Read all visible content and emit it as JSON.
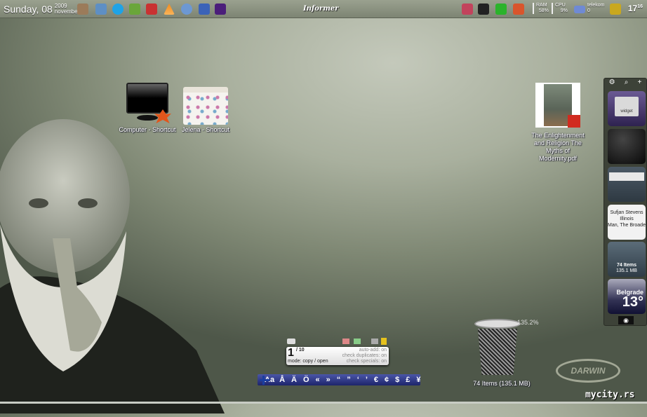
{
  "topbar": {
    "day": "Sunday, 08",
    "year": "2009",
    "month": "november",
    "title": "Informer",
    "ram_label": "RAM",
    "ram_value": "58%",
    "cpu_label": "CPU",
    "cpu_value": "9%",
    "mail_label": "telekom",
    "mail_count": "0",
    "clock_hour": "17",
    "clock_min": "16",
    "left_icons": [
      "contacts-icon",
      "explorer-icon",
      "skype-icon",
      "notepad-icon",
      "camera-app-icon",
      "vlc-icon",
      "itunes-icon",
      "word-icon",
      "winrar-icon"
    ],
    "right_icons": [
      "bookmark-icon",
      "camera-icon",
      "utorrent-icon",
      "firewall-icon"
    ]
  },
  "desktop": {
    "icons": [
      {
        "label": "Computer - Shortcut"
      },
      {
        "label": "Jelena - Shortcut"
      },
      {
        "label": "The Enlightenment and Religion The Myths of Modernity.pdf"
      }
    ]
  },
  "sidebar": {
    "widget_label": "widget",
    "music_artist": "Sufjan Stevens",
    "music_album": "Illinois",
    "music_track": "Man, The Broadest",
    "bin_items": "74 Items",
    "bin_size": "135.1 MB",
    "weather_city": "Belgrade",
    "weather_temp": "13°"
  },
  "recycle_bin": {
    "percent": "135.2%",
    "label": "74 Items (135.1 MB)"
  },
  "clipboard": {
    "count": "1",
    "total": "/ 10",
    "mode": "mode: copy / open",
    "auto_add": "auto-add: on",
    "check_dup": "check duplicates: on",
    "check_spec": "check specials: on"
  },
  "charbar": {
    "case_label": "Aa",
    "chars": [
      "Å",
      "Ä",
      "Ö",
      "«",
      "»",
      "“",
      "”",
      "‘",
      "’",
      "€",
      "¢",
      "$",
      "£",
      "¥"
    ]
  },
  "watermark": {
    "logo": "DARWIN",
    "site": "mycity.rs"
  }
}
